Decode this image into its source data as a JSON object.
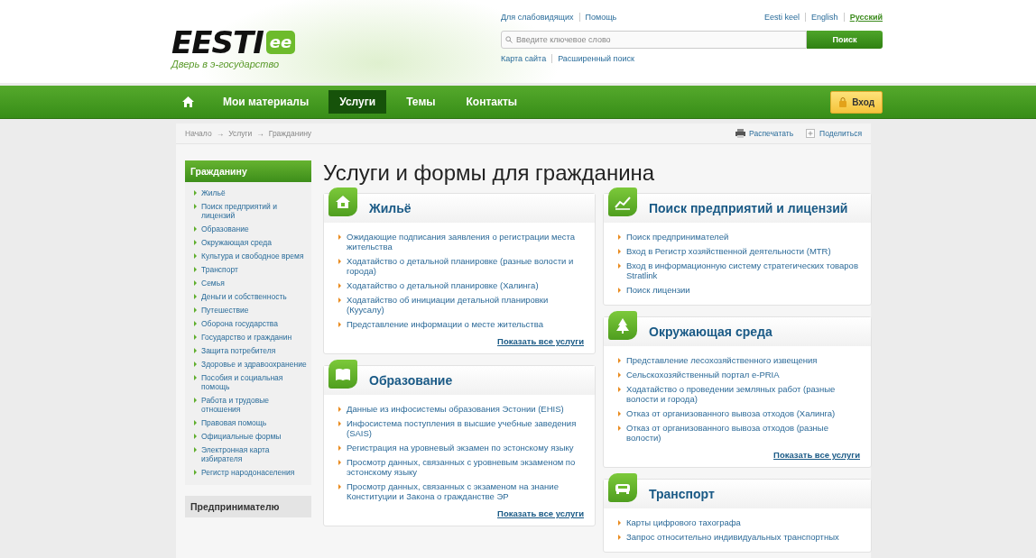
{
  "logo": {
    "name": "EESTI",
    "badge": "ee",
    "tagline": "Дверь в э-государство"
  },
  "top_links": [
    "Для слабовидящих",
    "Помощь"
  ],
  "languages": [
    {
      "label": "Eesti keel",
      "selected": false
    },
    {
      "label": "English",
      "selected": false
    },
    {
      "label": "Русский",
      "selected": true
    }
  ],
  "search": {
    "placeholder": "Введите ключевое слово",
    "button": "Поиск"
  },
  "search_links": [
    "Карта сайта",
    "Расширенный поиск"
  ],
  "nav": {
    "items": [
      {
        "label": "Мои материалы",
        "selected": false
      },
      {
        "label": "Услуги",
        "selected": true
      },
      {
        "label": "Темы",
        "selected": false
      },
      {
        "label": "Контакты",
        "selected": false
      }
    ],
    "login": "Вход"
  },
  "breadcrumb": [
    "Начало",
    "Услуги",
    "Гражданину"
  ],
  "breadcrumb_separator": "→",
  "page_actions": [
    "Распечатать",
    "Поделиться"
  ],
  "sidebar": {
    "sections": [
      {
        "title": "Гражданину",
        "selected": true,
        "items": [
          "Жильё",
          "Поиск предприятий и лицензий",
          "Образование",
          "Окружающая среда",
          "Культура и свободное время",
          "Транспорт",
          "Семья",
          "Деньги и собственность",
          "Путешествие",
          "Оборона государства",
          "Государство и гражданин",
          "Защита потребителя",
          "Здоровье и здравоохранение",
          "Пособия и социальная помощь",
          "Работа и трудовые отношения",
          "Правовая помощь",
          "Официальные формы",
          "Электронная карта избирателя",
          "Регистр народонаселения"
        ]
      },
      {
        "title": "Предпринимателю",
        "selected": false
      }
    ]
  },
  "page_title": "Услуги и формы для гражданина",
  "columns": [
    [
      {
        "title": "Жильё",
        "items": [
          "Ожидающие подписания заявления о регистрации места жительства",
          "Ходатайство о детальной планировке (разные волости и города)",
          "Ходатайство о детальной планировке (Халинга)",
          "Ходатайство об инициации детальной планировки (Куусалу)",
          "Представление информации о месте жительства"
        ],
        "more": "Показать все услуги"
      },
      {
        "title": "Образование",
        "items": [
          "Данные из инфосистемы образования Эстонии (EHIS)",
          "Инфосистема поступления в высшие учебные заведения (SAIS)",
          "Регистрация на уровневый экзамен по эстонскому языку",
          "Просмотр данных, связанных с уровневым экзаменом по эстонскому языку",
          "Просмотр данных, связанных с экзаменом на знание Конституции и Закона о гражданстве ЭР"
        ],
        "more": "Показать все услуги"
      }
    ],
    [
      {
        "title": "Поиск предприятий и лицензий",
        "items": [
          "Поиск предпринимателей",
          "Вход в Регистр хозяйственной деятельности (MTR)",
          "Вход в информационную систему стратегических товаров Stratlink",
          "Поиск лицензии"
        ]
      },
      {
        "title": "Окружающая среда",
        "items": [
          "Представление лесохозяйственного извещения",
          "Сельскохозяйственный портал e-PRIA",
          "Ходатайство о проведении земляных работ (разные волости и города)",
          "Отказ от организованного вывоза отходов (Халинга)",
          "Отказ от организованного вывоза отходов (разные волости)"
        ],
        "more": "Показать все услуги"
      },
      {
        "title": "Транспорт",
        "items": [
          "Карты цифрового тахографа",
          "Запрос относительно индивидуальных транспортных"
        ]
      }
    ]
  ]
}
